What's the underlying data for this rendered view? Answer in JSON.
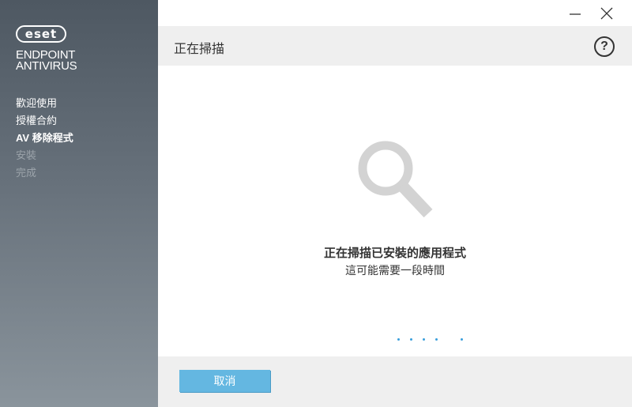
{
  "brand": {
    "logo_text": "eset",
    "product_line1": "ENDPOINT",
    "product_line2": "ANTIVIRUS"
  },
  "steps": [
    {
      "label": "歡迎使用",
      "state": "done"
    },
    {
      "label": "授權合約",
      "state": "done"
    },
    {
      "label": "AV 移除程式",
      "state": "active"
    },
    {
      "label": "安裝",
      "state": "pending"
    },
    {
      "label": "完成",
      "state": "pending"
    }
  ],
  "header": {
    "title": "正在掃描",
    "help_symbol": "?"
  },
  "main": {
    "icon": "search-icon",
    "title": "正在掃描已安裝的應用程式",
    "subtitle": "這可能需要一段時間"
  },
  "footer": {
    "cancel_label": "取消"
  },
  "colors": {
    "accent": "#64b7e1",
    "progress_dot": "#3b9fdc",
    "sidebar_top": "#4e5862",
    "sidebar_bottom": "#8a949c"
  }
}
